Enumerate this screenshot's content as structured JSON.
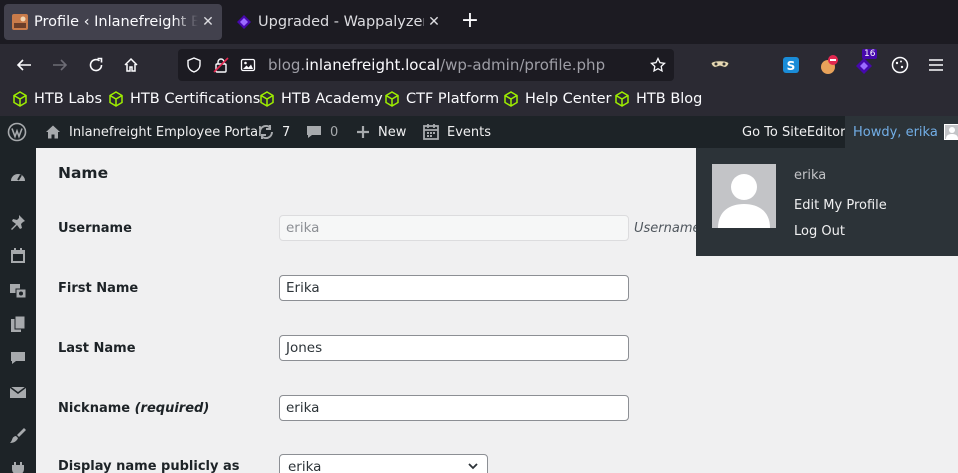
{
  "browser": {
    "tabs": [
      {
        "title": "Profile ‹ Inlanefreight Employee Portal",
        "close": "✕"
      },
      {
        "title": "Upgraded - Wappalyzer",
        "close": "✕"
      }
    ],
    "new_tab": "+",
    "url": {
      "prefix": "blog.",
      "host": "inlanefreight.local",
      "path": "/wp-admin/profile.php"
    },
    "extension_badge": "16",
    "bookmarks": [
      "HTB Labs",
      "HTB Certifications",
      "HTB Academy",
      "CTF Platform",
      "Help Center",
      "HTB Blog"
    ]
  },
  "adminbar": {
    "site_name": "Inlanefreight Employee Portal",
    "updates_count": "7",
    "comments_count": "0",
    "new_label": "New",
    "events_label": "Events",
    "site_editor": "Go To SiteEditor",
    "howdy": "Howdy, erika"
  },
  "dropdown": {
    "username": "erika",
    "edit_profile": "Edit My Profile",
    "logout": "Log Out"
  },
  "form": {
    "section_title": "Name",
    "username_label": "Username",
    "username_value": "erika",
    "username_desc": "Usernames cannot be changed.",
    "first_name_label": "First Name",
    "first_name_value": "Erika",
    "last_name_label": "Last Name",
    "last_name_value": "Jones",
    "nickname_label": "Nickname",
    "nickname_required": "(required)",
    "nickname_value": "erika",
    "display_name_label": "Display name publicly as",
    "display_name_value": "erika"
  },
  "colors": {
    "wp_dark": "#1d2327",
    "wp_link": "#72aee6",
    "browser_bg": "#1c1b22",
    "htb_green": "#9fef00"
  }
}
